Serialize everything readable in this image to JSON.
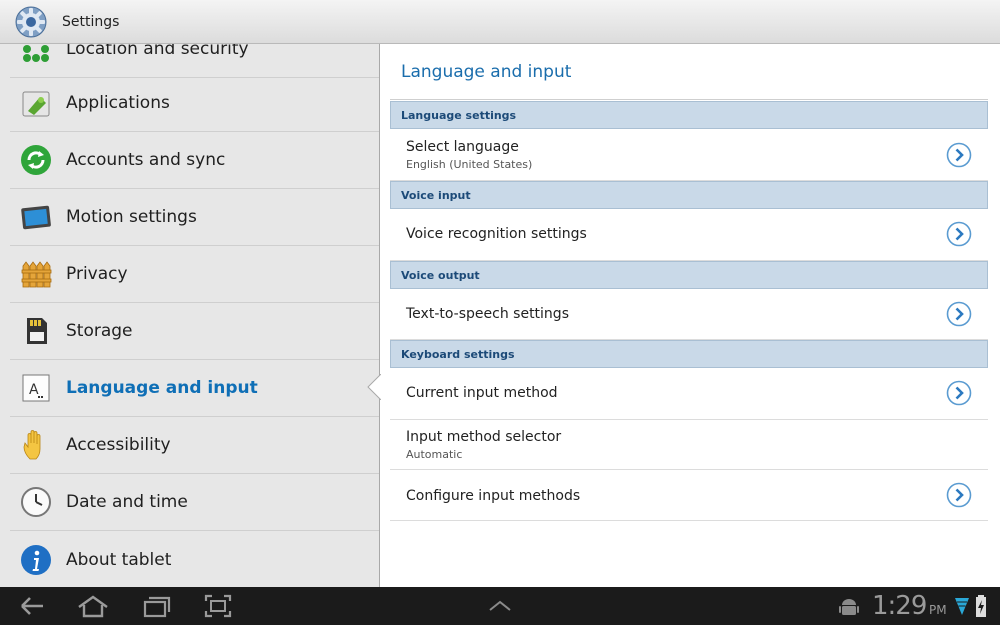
{
  "app": {
    "title": "Settings"
  },
  "sidebar": {
    "items": [
      {
        "label": "Location and security",
        "icon": "location-security-icon",
        "selected": false
      },
      {
        "label": "Applications",
        "icon": "applications-icon",
        "selected": false
      },
      {
        "label": "Accounts and sync",
        "icon": "sync-icon",
        "selected": false
      },
      {
        "label": "Motion settings",
        "icon": "motion-icon",
        "selected": false
      },
      {
        "label": "Privacy",
        "icon": "privacy-fence-icon",
        "selected": false
      },
      {
        "label": "Storage",
        "icon": "sd-card-icon",
        "selected": false
      },
      {
        "label": "Language and input",
        "icon": "language-icon",
        "selected": true
      },
      {
        "label": "Accessibility",
        "icon": "hand-icon",
        "selected": false
      },
      {
        "label": "Date and time",
        "icon": "clock-icon",
        "selected": false
      },
      {
        "label": "About tablet",
        "icon": "info-icon",
        "selected": false
      }
    ]
  },
  "main": {
    "title": "Language and input",
    "sections": [
      {
        "header": "Language settings",
        "rows": [
          {
            "title": "Select language",
            "subtitle": "English (United States)",
            "chevron": true
          }
        ]
      },
      {
        "header": "Voice input",
        "rows": [
          {
            "title": "Voice recognition settings",
            "chevron": true
          }
        ]
      },
      {
        "header": "Voice output",
        "rows": [
          {
            "title": "Text-to-speech settings",
            "chevron": true
          }
        ]
      },
      {
        "header": "Keyboard settings",
        "rows": [
          {
            "title": "Current input method",
            "chevron": true
          },
          {
            "title": "Input method selector",
            "subtitle": "Automatic",
            "chevron": false
          },
          {
            "title": "Configure input methods",
            "chevron": true
          }
        ]
      }
    ]
  },
  "statusbar": {
    "time": "1:29",
    "ampm": "PM"
  },
  "colors": {
    "accent": "#0f6fb6",
    "section_header_bg": "#c9d9e8",
    "sidebar_bg": "#e7e7e7",
    "systembar_bg": "#1b1b1b"
  }
}
